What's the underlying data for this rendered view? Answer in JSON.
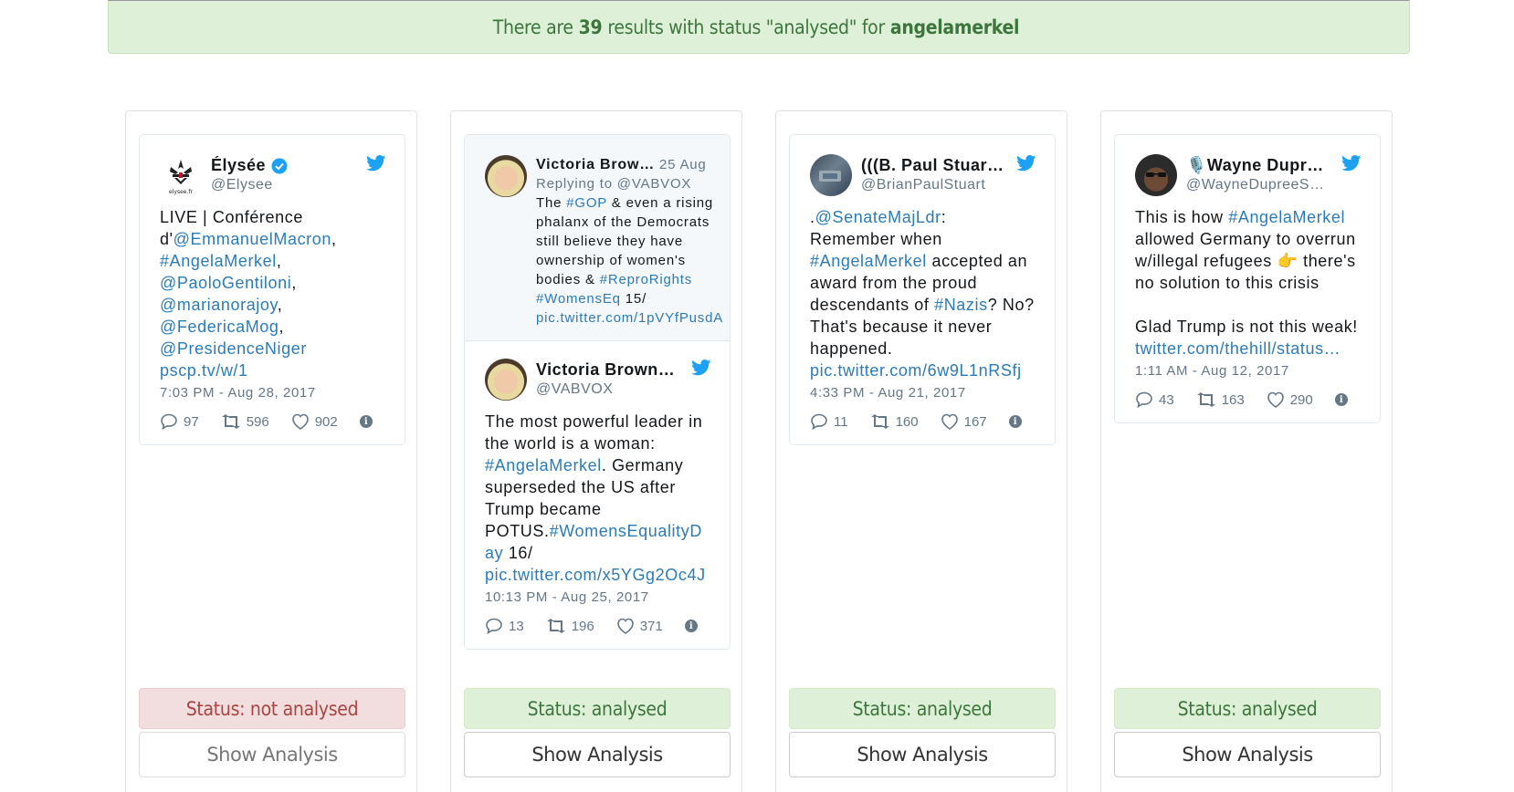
{
  "banner": {
    "prefix": "There are",
    "count": "39",
    "middle": "results with status \"analysed\" for",
    "query": "angelamerkel"
  },
  "colors": {
    "link": "#2b7bb9",
    "twitter_blue": "#1da1f2",
    "success_bg": "#dff0d8",
    "danger_bg": "#f2dede"
  },
  "cards": [
    {
      "tweet": {
        "display_name": "Élysée",
        "handle": "@Elysee",
        "verified": true,
        "avatar_icon": "elysee-logo-icon",
        "body": [
          {
            "t": "LIVE | Conférence d'"
          },
          {
            "t": "@EmmanuelMacron",
            "link": true
          },
          {
            "t": ", "
          },
          {
            "t": "#AngelaMerkel",
            "link": true
          },
          {
            "t": ", "
          },
          {
            "t": "@PaoloGentiloni",
            "link": true
          },
          {
            "t": ", "
          },
          {
            "t": "@marianorajoy",
            "link": true
          },
          {
            "t": ", "
          },
          {
            "t": "@FedericaMog",
            "link": true
          },
          {
            "t": ", "
          },
          {
            "t": "@PresidenceNiger",
            "link": true
          },
          {
            "t": " pscp.tv/w/1",
            "link": true
          }
        ],
        "time": "7:03 PM - Aug 28, 2017",
        "replies": "97",
        "retweets": "596",
        "likes": "902"
      },
      "status": "Status: not analysed",
      "status_type": "danger",
      "button": "Show Analysis"
    },
    {
      "quoted": {
        "display_name": "Victoria Brow…",
        "date": "25 Aug",
        "replying_to": "Replying to @VABVOX",
        "body": [
          {
            "t": "The "
          },
          {
            "t": "#GOP",
            "link": true
          },
          {
            "t": " & even a rising phalanx of the Democrats still believe they have ownership of women's bodies & "
          },
          {
            "t": "#ReproRights",
            "link": true
          },
          {
            "t": " "
          },
          {
            "t": "#WomensEq",
            "link": true
          },
          {
            "t": " 15/ "
          },
          {
            "t": "pic.twitter.com/1pVYfPusdA",
            "link": true
          }
        ]
      },
      "tweet": {
        "display_name": "Victoria Brown…",
        "handle": "@VABVOX",
        "verified": false,
        "avatar_icon": "victoria-avatar-icon",
        "body": [
          {
            "t": "The most powerful leader in the world is a woman: "
          },
          {
            "t": "#AngelaMerkel",
            "link": true
          },
          {
            "t": ". Germany superseded the US after Trump became POTUS."
          },
          {
            "t": "#WomensEqualityDay",
            "link": true
          },
          {
            "t": " 16/ "
          },
          {
            "t": "pic.twitter.com/x5YGg2Oc4J",
            "link": true
          }
        ],
        "time": "10:13 PM - Aug 25, 2017",
        "replies": "13",
        "retweets": "196",
        "likes": "371"
      },
      "status": "Status: analysed",
      "status_type": "success",
      "button": "Show Analysis"
    },
    {
      "tweet": {
        "display_name": "(((B. Paul Stuar…",
        "handle": "@BrianPaulStuart",
        "verified": false,
        "avatar_icon": "paul-avatar-icon",
        "body": [
          {
            "t": "."
          },
          {
            "t": "@SenateMajLdr",
            "link": true
          },
          {
            "t": ": Remember when "
          },
          {
            "t": "#AngelaMerkel",
            "link": true
          },
          {
            "t": " accepted an award from the proud descendants of "
          },
          {
            "t": "#Nazis",
            "link": true
          },
          {
            "t": "? No? That's because it never happened. "
          },
          {
            "t": "pic.twitter.com/6w9L1nRSfj",
            "link": true
          }
        ],
        "time": "4:33 PM - Aug 21, 2017",
        "replies": "11",
        "retweets": "160",
        "likes": "167"
      },
      "status": "Status: analysed",
      "status_type": "success",
      "button": "Show Analysis"
    },
    {
      "tweet": {
        "display_name": "🎙️Wayne Dupr…",
        "handle": "@WayneDupreeS…",
        "verified": false,
        "avatar_icon": "wayne-avatar-icon",
        "body": [
          {
            "t": "This is how "
          },
          {
            "t": "#AngelaMerkel",
            "link": true
          },
          {
            "t": " allowed Germany to overrun w/illegal refugees 👉 there's no solution to this crisis\n\nGlad Trump is not this weak!\n"
          },
          {
            "t": "twitter.com/thehill/status…",
            "link": true
          }
        ],
        "time": "1:11 AM - Aug 12, 2017",
        "replies": "43",
        "retweets": "163",
        "likes": "290"
      },
      "status": "Status: analysed",
      "status_type": "success",
      "button": "Show Analysis"
    }
  ]
}
